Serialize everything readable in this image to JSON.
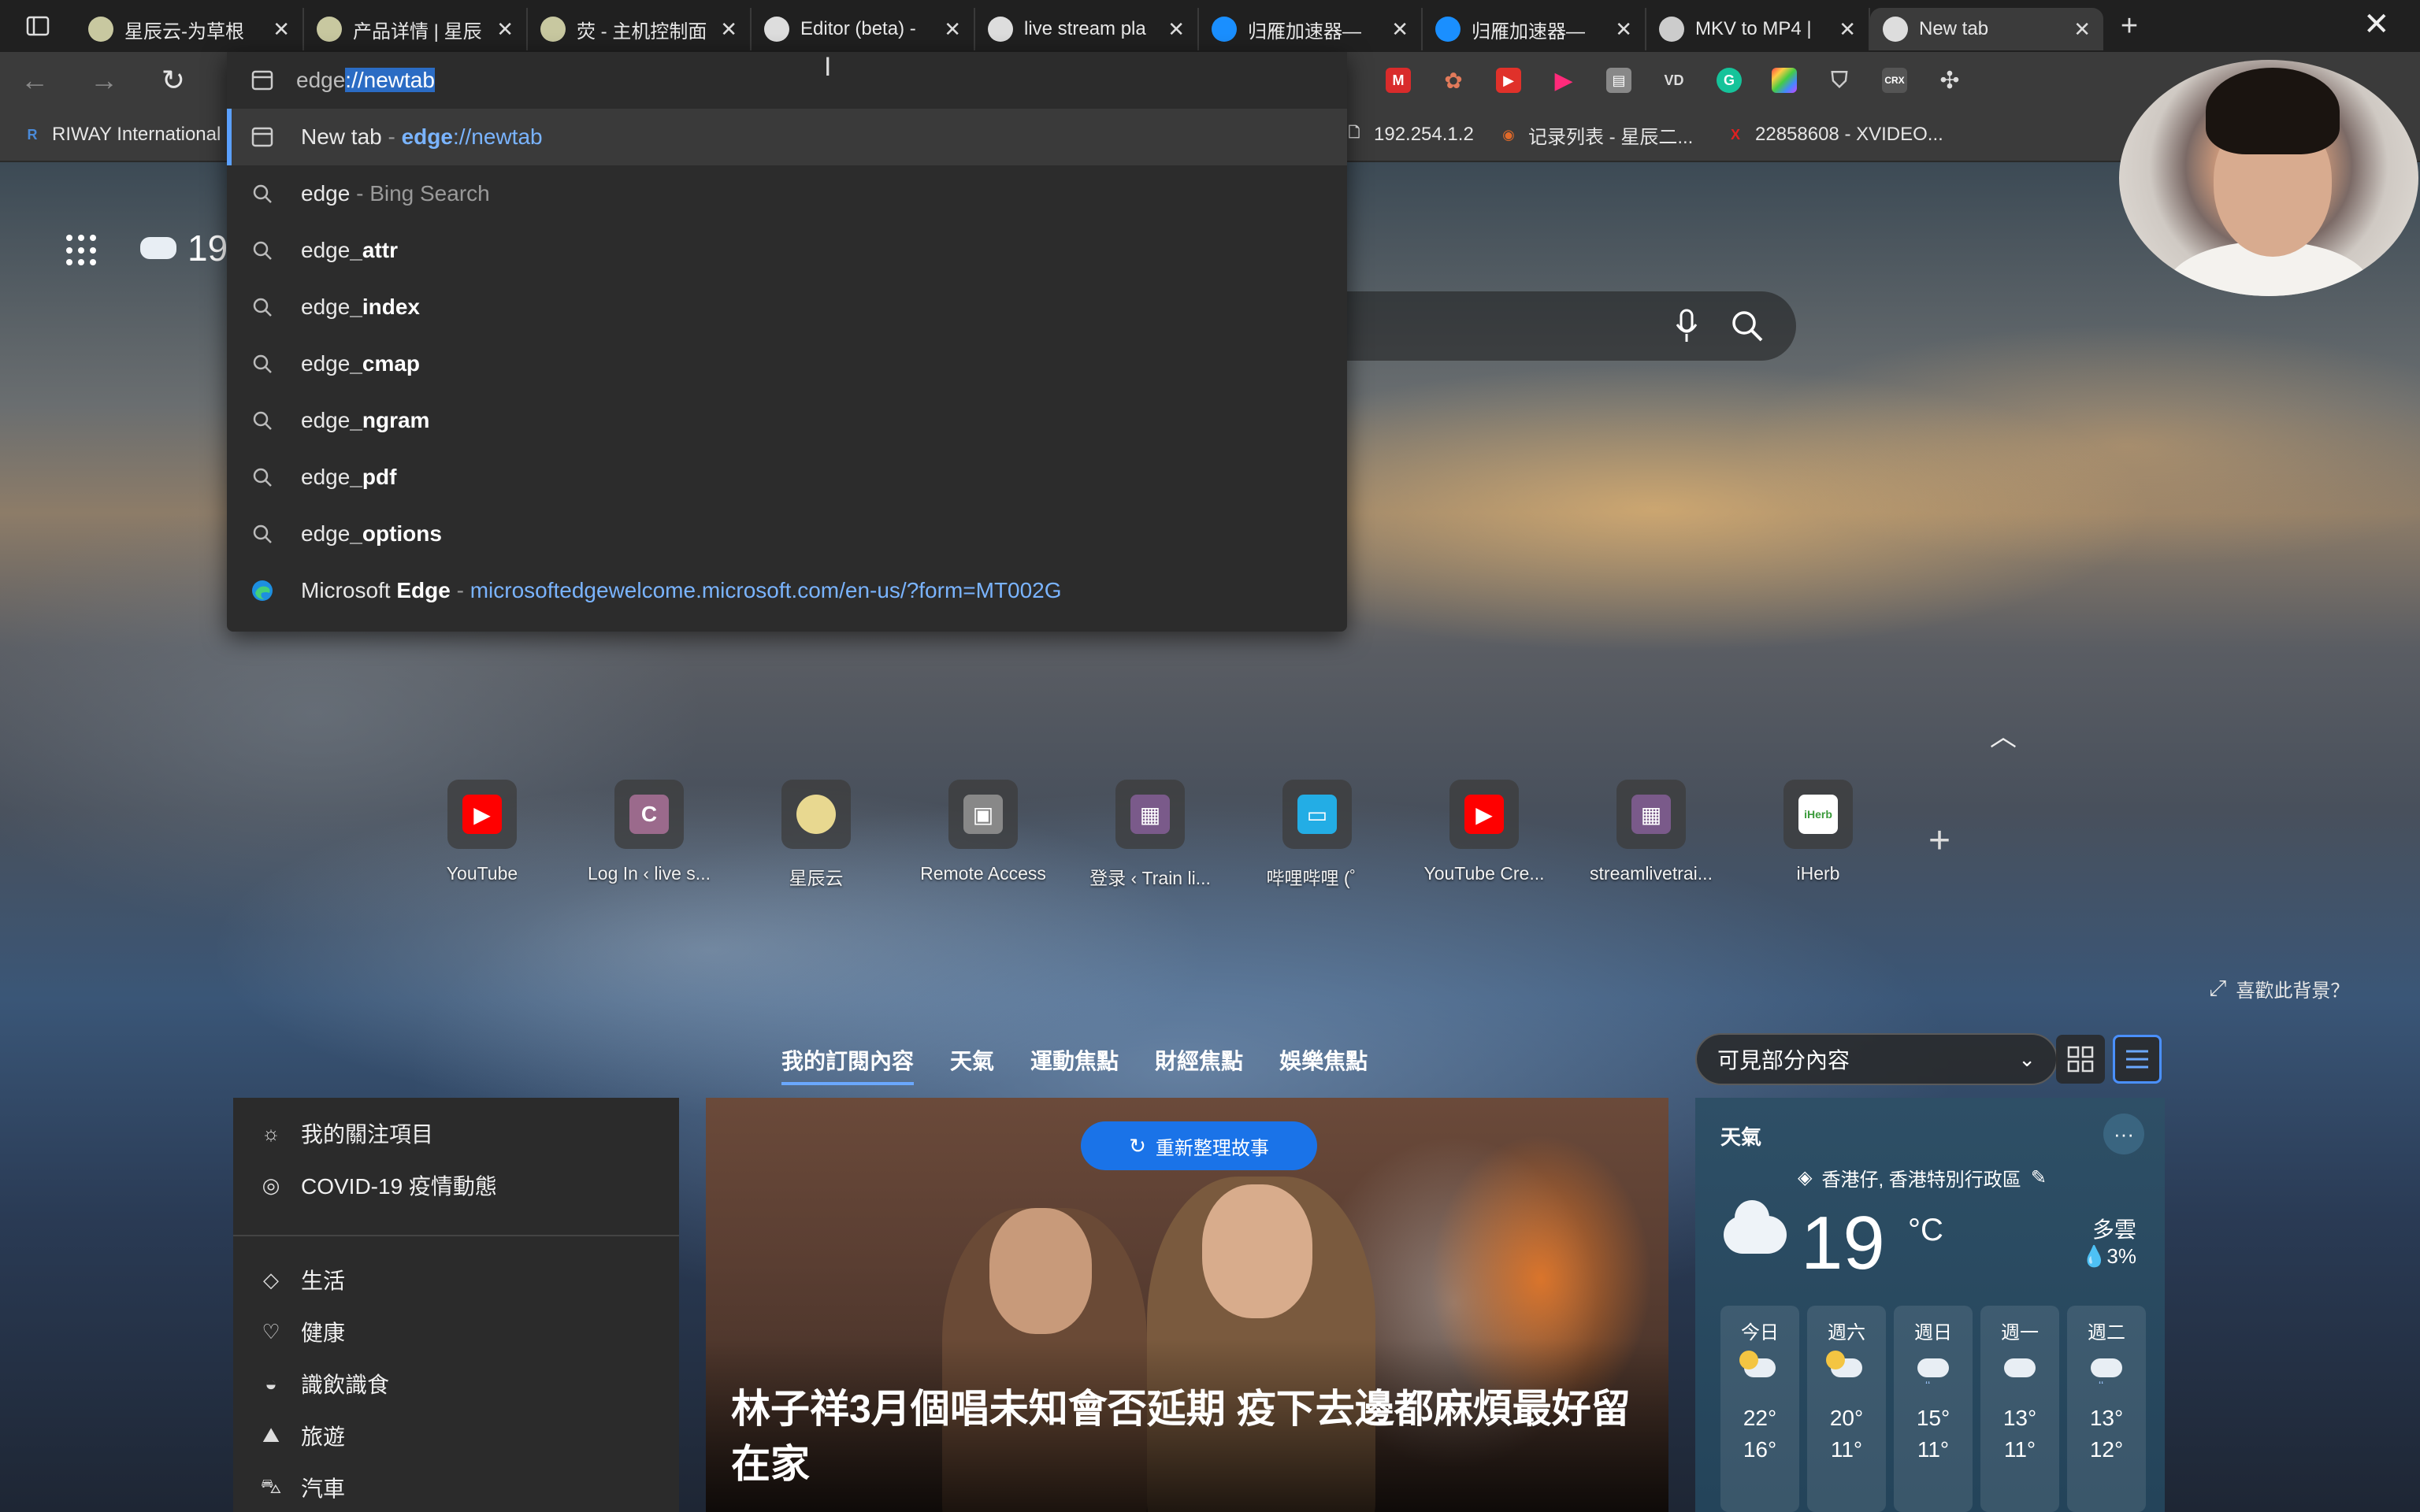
{
  "tabs": [
    {
      "title": "星辰云-为草根",
      "favicon_color": "#c8c8a0",
      "active": false
    },
    {
      "title": "产品详情 | 星辰",
      "favicon_color": "#c8c8a0",
      "active": false
    },
    {
      "title": "荧 - 主机控制面",
      "favicon_color": "#c8c8a0",
      "active": false
    },
    {
      "title": "Editor (beta) -",
      "favicon_color": "#dddddd",
      "active": false
    },
    {
      "title": "live stream pla",
      "favicon_color": "#dddddd",
      "active": false
    },
    {
      "title": "归雁加速器—",
      "favicon_color": "#1a8fff",
      "active": false
    },
    {
      "title": "归雁加速器—",
      "favicon_color": "#1a8fff",
      "active": false
    },
    {
      "title": "MKV to MP4 |",
      "favicon_color": "#cccccc",
      "active": false
    },
    {
      "title": "New tab",
      "favicon_color": "#dddddd",
      "active": true
    }
  ],
  "omnibox": {
    "typed": "edge",
    "selected_completion": "://newtab",
    "suggestions": [
      {
        "icon": "newtab-icon",
        "text": "New tab",
        "sep": " - ",
        "detail_bold": "edge",
        "detail_rest": "://newtab",
        "kind": "url"
      },
      {
        "icon": "search-icon",
        "text": "edge",
        "sep": " - ",
        "detail_rest": "Bing Search",
        "kind": "dim"
      },
      {
        "icon": "search-icon",
        "prefix": "edge",
        "suffix": "_attr"
      },
      {
        "icon": "search-icon",
        "prefix": "edge",
        "suffix": "_index"
      },
      {
        "icon": "search-icon",
        "prefix": "edge",
        "suffix": "_cmap"
      },
      {
        "icon": "search-icon",
        "prefix": "edge",
        "suffix": "_ngram"
      },
      {
        "icon": "search-icon",
        "prefix": "edge",
        "suffix": "_pdf"
      },
      {
        "icon": "search-icon",
        "prefix": "edge",
        "suffix": "_options"
      }
    ],
    "edge_row": {
      "text_a": "Microsoft ",
      "text_b": "Edge",
      "sep": " - ",
      "url": "microsoftedgewelcome.microsoft.com/en-us/?form=MT002G"
    }
  },
  "bookmarks": [
    {
      "label": "RIWAY International",
      "icon": "R"
    },
    {
      "label": "192.254.1.2",
      "icon": "doc"
    },
    {
      "label": "记录列表 - 星辰二...",
      "icon": "circle"
    },
    {
      "label": "22858608 - XVIDEO...",
      "icon": "X"
    }
  ],
  "weather_mini": {
    "temp": "19"
  },
  "quick_links": [
    {
      "label": "YouTube",
      "glyph": "▶",
      "color": "#ff0000"
    },
    {
      "label": "Log In ‹ live s...",
      "glyph": "C",
      "color": "#9b6a8c"
    },
    {
      "label": "星辰云",
      "glyph": "",
      "color": "#e8d890"
    },
    {
      "label": "Remote Access",
      "glyph": "▣",
      "color": "#888888"
    },
    {
      "label": "登录 ‹ Train li...",
      "glyph": "▦",
      "color": "#7a5a8a"
    },
    {
      "label": "哔哩哔哩 (゜",
      "glyph": "▭",
      "color": "#23ade5"
    },
    {
      "label": "YouTube Cre...",
      "glyph": "▶",
      "color": "#ff0000"
    },
    {
      "label": "streamlivetrai...",
      "glyph": "▦",
      "color": "#7a5a8a"
    },
    {
      "label": "iHerb",
      "glyph": "iHerb",
      "color": "#ffffff"
    }
  ],
  "bg_like": "喜歡此背景？",
  "feed_tabs": [
    "我的訂閱內容",
    "天氣",
    "運動焦點",
    "財經焦點",
    "娛樂焦點"
  ],
  "content_select": "可見部分內容",
  "left_menu": {
    "top": [
      {
        "icon": "sun-icon",
        "label": "我的關注項目"
      },
      {
        "icon": "globe-icon",
        "label": "COVID-19 疫情動態"
      }
    ],
    "bottom": [
      {
        "icon": "diamond-icon",
        "label": "生活"
      },
      {
        "icon": "heart-icon",
        "label": "健康"
      },
      {
        "icon": "food-icon",
        "label": "識飲識食"
      },
      {
        "icon": "travel-icon",
        "label": "旅遊"
      },
      {
        "icon": "car-icon",
        "label": "汽車"
      }
    ]
  },
  "hero": {
    "reshuffle": "重新整理故事",
    "title": "林子祥3月個唱未知會否延期 疫下去邊都麻煩最好留在家"
  },
  "weather_card": {
    "title": "天氣",
    "location": "香港仔, 香港特別行政區",
    "temp": "19",
    "unit": "°C",
    "condition": "多雲",
    "rain": "3%",
    "forecast": [
      {
        "day": "今日",
        "hi": "22°",
        "lo": "16°",
        "icon": "partly-sunny"
      },
      {
        "day": "週六",
        "hi": "20°",
        "lo": "11°",
        "icon": "partly-sunny"
      },
      {
        "day": "週日",
        "hi": "15°",
        "lo": "11°",
        "icon": "rain"
      },
      {
        "day": "週一",
        "hi": "13°",
        "lo": "11°",
        "icon": "cloudy"
      },
      {
        "day": "週二",
        "hi": "13°",
        "lo": "12°",
        "icon": "rain"
      }
    ]
  }
}
